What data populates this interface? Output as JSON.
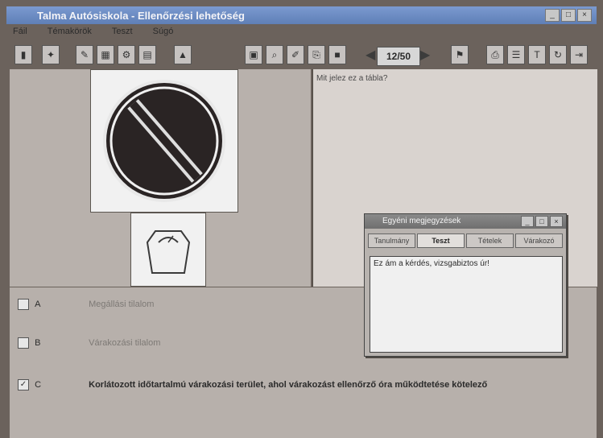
{
  "window": {
    "title": "Talma Autósiskola - Ellenőrzési lehetőség",
    "controls": [
      "_",
      "□",
      "×"
    ]
  },
  "menu": [
    "Fáil",
    "Témakörök",
    "Teszt",
    "Súgó"
  ],
  "toolbar": {
    "counter": "12/50",
    "prev_icon": "◀",
    "next_icon": "▶"
  },
  "question": "Mit jelez ez a tábla?",
  "answers": [
    {
      "label": "A",
      "text": "Megállási tilalom",
      "checked": false
    },
    {
      "label": "B",
      "text": "Várakozási tilalom",
      "checked": false
    },
    {
      "label": "C",
      "text": "Korlátozott időtartalmú várakozási terület, ahol várakozást ellenőrző óra működtetése kötelező",
      "checked": true
    }
  ],
  "notes": {
    "title": "Egyéni megjegyzések",
    "tabs": [
      "Tanulmány",
      "Teszt",
      "Tételek",
      "Várakozó"
    ],
    "active_tab": "Teszt",
    "content": "Ez ám a kérdés, vizsgabiztos úr!"
  }
}
